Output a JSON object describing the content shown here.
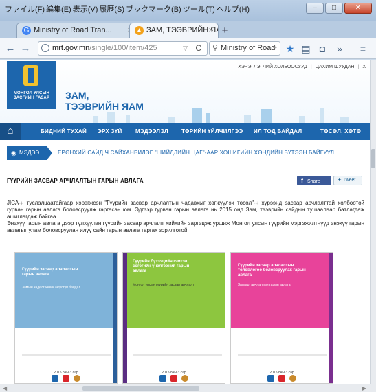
{
  "browser": {
    "menu": [
      "ファイル(F)",
      "編集(E)",
      "表示(V)",
      "履歴(S)",
      "ブックマーク(B)",
      "ツール(T)",
      "ヘルプ(H)"
    ],
    "tabs": [
      {
        "label": "Ministry of Road  Tran...",
        "active": false
      },
      {
        "label": "ЗАМ, ТЭЭВРИЙН ЯАМ ...",
        "active": true
      }
    ],
    "url": {
      "domain": "mrt.gov.mn",
      "path": "/single/100/item/425"
    },
    "search_value": "Ministry of Road",
    "colors": {
      "chrome": "#b7cbe1",
      "brand": "#1d66ad"
    }
  },
  "site": {
    "logo_text": "МОНГОЛ УЛСЫН ЗАСГИЙН ГАЗАР",
    "title_line1": "ЗАМ,",
    "title_line2": "ТЭЭВРИЙН ЯАМ",
    "top_links": [
      "ХЭРЭГЛЭГЧИЙ ХОЛБООСУУД",
      "ЦАХИМ ШУУДАН",
      "X"
    ],
    "nav": [
      "БИДНИЙ ТУХАЙ",
      "ЭРХ ЗҮЙ",
      "МЭДЭЭЛЭЛ",
      "ТӨРИЙН ҮЙЛЧИЛГЭЭ",
      "ИЛ ТОД БАЙДАЛ",
      "ТӨСӨЛ, ХӨТӨ"
    ]
  },
  "ticker": {
    "label": "МЭДЭЭ",
    "text": "ЕРӨНХИЙ САЙД Ч.САЙХАНБИЛЭГ \"ШИЙДЛИЙН ЦАГ\"-ААР ХОШИГИЙН ХӨНДИЙН БҮТЭЭН БАЙГУУЛ"
  },
  "article": {
    "title": "ГҮҮРИЙН ЗАСВАР АРЧЛАЛТЫН ГАРЫН АВЛАГА",
    "share_label": "Share",
    "tweet_label": "Tweet",
    "paragraph1": "JICA-н туслалцаатайгаар хэрэгжсэн \"Гүүрийн засвар арчлалтын чадавхыг хөгжүүлэх төсөл\"-н хүрээнд засвар арчлалттай холбоотой гурван гарын авлага боловсруулж гаргасан юм. Эдгээр гурван гарын авлага нь 2015 онд Зам, тээврийн сайдын тушаалаар батлагдаж ашиглагдаж байгаа.",
    "paragraph2": "Энэхүү гарын авлага дээр түлхүүлэн гүүрийн засвар арчлалт хийхийн заргэцэж уршиж Монгол улсын гүүрийн мэргэжилтнүүд энэхүү гарын авлагыг улам боловсруулан илүү сайн гарын авлага гаргах зорилготой."
  },
  "covers": [
    {
      "title": "Гүүрийн засвар арчлалтын гарын авлага",
      "subtitle": "Замын хөдөлгөөний аюулгүй байдал",
      "year": "2015 оны 3 сар",
      "color": "#7fb3d9",
      "stripe": "#2c5f9a"
    },
    {
      "title": "Гүүрийн бүтээцийн гэмтэл, согогийн үнэлгээний гарын авлага",
      "subtitle": "Монгол улсын гүүрийн засвар арчлалт",
      "year": "2015 оны 3 сар",
      "color": "#8dc63f",
      "stripe": "#5a2d82"
    },
    {
      "title": "Гүүрийн засвар арчлалтын төлөвлөгөө боловсруулах гарын авлага",
      "subtitle": "Засвар, арчлалтын гарын авлага",
      "year": "2015 оны 3 сар",
      "color": "#e8439a",
      "stripe": "#7a2f8f"
    }
  ]
}
